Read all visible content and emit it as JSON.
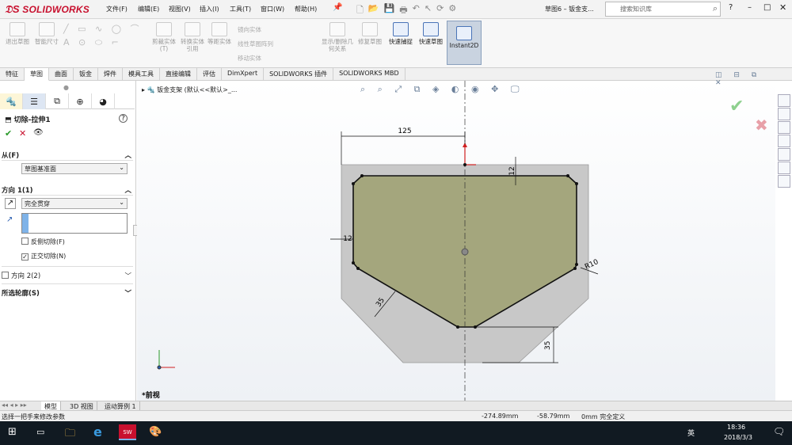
{
  "app": {
    "logo": "SOLIDWORKS",
    "doc_title": "草图6 – 钣金支...",
    "search_placeholder": "搜索知识库"
  },
  "menu": [
    "文件(F)",
    "编辑(E)",
    "视图(V)",
    "插入(I)",
    "工具(T)",
    "窗口(W)",
    "帮助(H)"
  ],
  "ribbon": {
    "exit_sketch": "退出草图",
    "smart_dim": "智能尺寸",
    "trim": "剪裁实体(T)",
    "convert": "转换实体引用",
    "offset": "等距实体",
    "mirror": "镜向实体",
    "linear_pattern": "线性草图阵列",
    "move": "移动实体",
    "display_delete": "显示/删除几何关系",
    "repair": "修复草图",
    "quick_snap": "快速捕捉",
    "rapid_sketch": "快速草图",
    "instant2d": "Instant2D"
  },
  "tabs": [
    "特征",
    "草图",
    "曲面",
    "钣金",
    "焊件",
    "模具工具",
    "直接编辑",
    "评估",
    "DimXpert",
    "SOLIDWORKS 插件",
    "SOLIDWORKS MBD"
  ],
  "active_tab": "草图",
  "panel": {
    "title": "切除-拉伸1",
    "from_label": "从(F)",
    "from_value": "草图基准面",
    "dir1_label": "方向 1(1)",
    "dir1_value": "完全贯穿",
    "flip_side": "反侧切除(F)",
    "normal_cut": "正交切除(N)",
    "dir2_label": "方向 2(2)",
    "contours_label": "所选轮廓(S)"
  },
  "tree": {
    "part": "钣金支架 (默认<<默认>_..."
  },
  "drawing": {
    "dim_width": "125",
    "dim_top": "12",
    "dim_left": "12",
    "radius": "R10",
    "dim_chamfer": "35",
    "dim_bottom": "35",
    "view_label": "*前视"
  },
  "bottom_tabs": [
    "模型",
    "3D 视图",
    "运动算例 1"
  ],
  "status": {
    "hint": "选择一把手来修改参数",
    "x": "-274.89mm",
    "y": "-58.79mm",
    "z": "0mm 完全定义"
  },
  "taskbar": {
    "time": "18:36",
    "date": "2018/3/3",
    "ime": "英"
  },
  "colors": {
    "face": "#a4a67d",
    "plate": "#c8c8c8",
    "accent": "#c8102e"
  }
}
